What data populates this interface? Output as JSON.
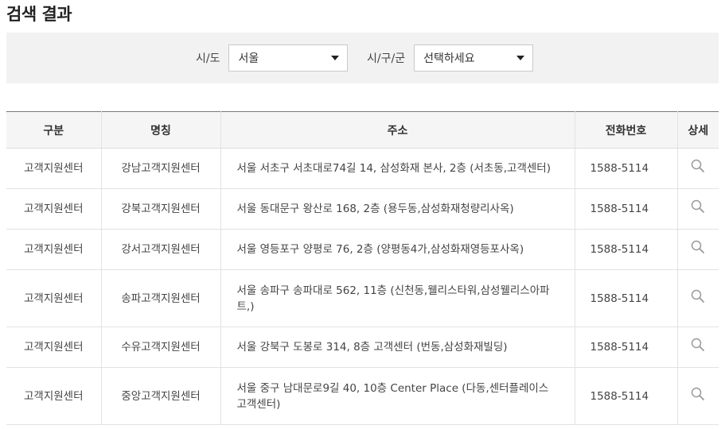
{
  "page": {
    "title": "검색 결과"
  },
  "filters": {
    "sido": {
      "label": "시/도",
      "value": "서울"
    },
    "sigungu": {
      "label": "시/구/군",
      "value": "선택하세요"
    }
  },
  "table": {
    "headers": {
      "type": "구분",
      "name": "명칭",
      "address": "주소",
      "phone": "전화번호",
      "detail": "상세"
    },
    "rows": [
      {
        "type": "고객지원센터",
        "name": "강남고객지원센터",
        "address": "서울 서초구 서초대로74길 14, 삼성화재 본사, 2층 (서초동,고객센터)",
        "phone": "1588-5114"
      },
      {
        "type": "고객지원센터",
        "name": "강북고객지원센터",
        "address": "서울 동대문구 왕산로 168, 2층 (용두동,삼성화재청량리사옥)",
        "phone": "1588-5114"
      },
      {
        "type": "고객지원센터",
        "name": "강서고객지원센터",
        "address": "서울 영등포구 양평로 76, 2층 (양평동4가,삼성화재영등포사옥)",
        "phone": "1588-5114"
      },
      {
        "type": "고객지원센터",
        "name": "송파고객지원센터",
        "address": "서울 송파구 송파대로 562, 11층 (신천동,웰리스타워,삼성웰리스아파트,)",
        "phone": "1588-5114"
      },
      {
        "type": "고객지원센터",
        "name": "수유고객지원센터",
        "address": "서울 강북구 도봉로 314, 8층 고객센터 (번동,삼성화재빌딩)",
        "phone": "1588-5114"
      },
      {
        "type": "고객지원센터",
        "name": "중앙고객지원센터",
        "address": "서울 중구 남대문로9길 40, 10층 Center Place (다동,센터플레이스 고객센터)",
        "phone": "1588-5114"
      }
    ]
  },
  "icons": {
    "detail": "search-icon",
    "dropdown": "caret-down-icon"
  },
  "colors": {
    "filter_bg": "#f2f2f2",
    "header_bg": "#f5f5f5",
    "border": "#e2e2e2"
  }
}
